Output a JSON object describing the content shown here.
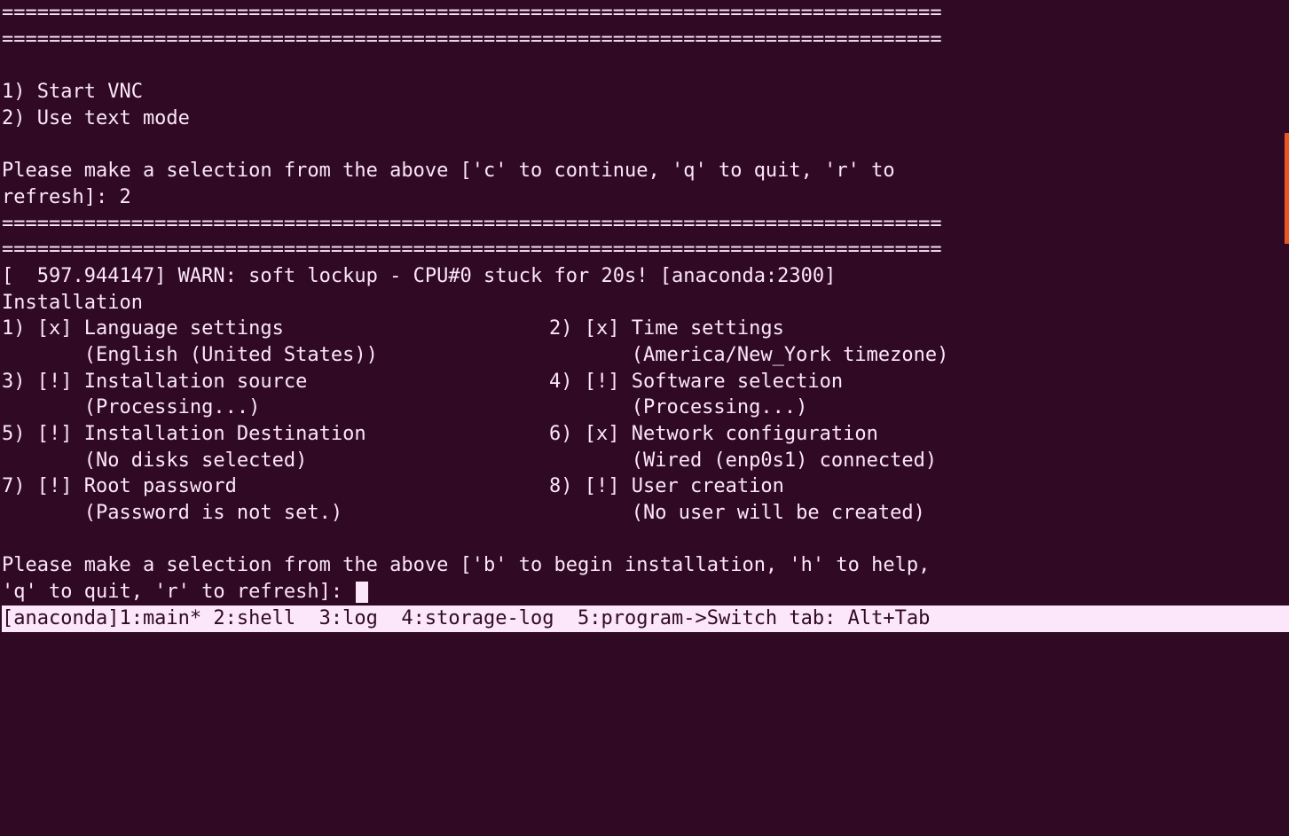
{
  "hr1": "================================================================================",
  "hr2": "================================================================================",
  "top_menu": {
    "item1": "1) Start VNC",
    "item2": "2) Use text mode"
  },
  "top_prompt": "Please make a selection from the above ['c' to continue, 'q' to quit, 'r' to\nrefresh]: 2",
  "hr3": "================================================================================",
  "hr4": "================================================================================",
  "kernel_line": "[  597.944147] WARN: soft lockup - CPU#0 stuck for 20s! [anaconda:2300]",
  "heading": "Installation",
  "menu_items": [
    {
      "num": "1",
      "mark": "x",
      "title": "Language settings",
      "sub": "(English (United States))"
    },
    {
      "num": "2",
      "mark": "x",
      "title": "Time settings",
      "sub": "(America/New_York timezone)"
    },
    {
      "num": "3",
      "mark": "!",
      "title": "Installation source",
      "sub": "(Processing...)"
    },
    {
      "num": "4",
      "mark": "!",
      "title": "Software selection",
      "sub": "(Processing...)"
    },
    {
      "num": "5",
      "mark": "!",
      "title": "Installation Destination",
      "sub": "(No disks selected)"
    },
    {
      "num": "6",
      "mark": "x",
      "title": "Network configuration",
      "sub": "(Wired (enp0s1) connected)"
    },
    {
      "num": "7",
      "mark": "!",
      "title": "Root password",
      "sub": "(Password is not set.)"
    },
    {
      "num": "8",
      "mark": "!",
      "title": "User creation",
      "sub": "(No user will be created)"
    }
  ],
  "col_left": {
    "l1": "1) [x] Language settings",
    "l1s": "       (English (United States))",
    "l3": "3) [!] Installation source",
    "l3s": "       (Processing...)",
    "l5": "5) [!] Installation Destination",
    "l5s": "       (No disks selected)",
    "l7": "7) [!] Root password",
    "l7s": "       (Password is not set.)"
  },
  "col_right": {
    "l2": "2) [x] Time settings",
    "l2s": "       (America/New_York timezone)",
    "l4": "4) [!] Software selection",
    "l4s": "       (Processing...)",
    "l6": "6) [x] Network configuration",
    "l6s": "       (Wired (enp0s1) connected)",
    "l8": "8) [!] User creation",
    "l8s": "       (No user will be created)"
  },
  "bottom_prompt_line1": "Please make a selection from the above ['b' to begin installation, 'h' to help,",
  "bottom_prompt_line2_pre": "'q' to quit, 'r' to refresh]: ",
  "statusbar": "[anaconda]1:main* 2:shell  3:log  4:storage-log  5:program->Switch tab: Alt+Tab ",
  "colors": {
    "bg": "#300a24",
    "fg": "#fce6f9",
    "accent": "#e95420"
  }
}
